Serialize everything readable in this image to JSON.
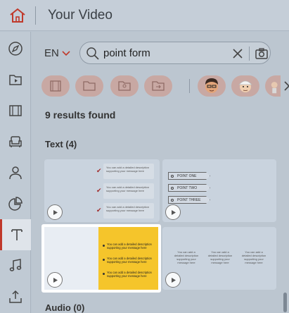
{
  "header": {
    "title": "Your Video",
    "home_icon": "home-icon"
  },
  "sidebar": {
    "items": [
      {
        "icon": "compass-icon",
        "active": false
      },
      {
        "icon": "media-folder-icon",
        "active": false
      },
      {
        "icon": "film-icon",
        "active": false
      },
      {
        "icon": "armchair-icon",
        "active": false
      },
      {
        "icon": "person-icon",
        "active": false
      },
      {
        "icon": "pie-chart-icon",
        "active": false
      },
      {
        "icon": "text-icon",
        "active": true
      },
      {
        "icon": "music-icon",
        "active": false
      },
      {
        "icon": "upload-icon",
        "active": false
      }
    ],
    "active_accent": "#c0392b"
  },
  "search": {
    "language": "EN",
    "query": "point form"
  },
  "categories": [
    {
      "icon": "film-strip-icon"
    },
    {
      "icon": "folder-icon"
    },
    {
      "icon": "image-folder-icon"
    },
    {
      "icon": "export-folder-icon"
    },
    {
      "icon": "character-avatar-icon"
    },
    {
      "icon": "character-avatar-icon"
    },
    {
      "icon": "character-avatar-icon"
    }
  ],
  "results": {
    "count_label": "9 results found"
  },
  "sections": {
    "text_title": "Text (4)",
    "audio_title": "Audio (0)"
  },
  "thumbnails": {
    "check_list": {
      "item_text": "You can add a detailed description supporting your message here"
    },
    "point_list": {
      "items": [
        "POINT ONE",
        "POINT TWO",
        "POINT THREE"
      ]
    },
    "yellow_list": {
      "item_text": "You can add a detailed description supporting your message here",
      "accent": "#f5c52b"
    },
    "three_column": {
      "item_text": "You can add a detailed description supporting your message here"
    }
  }
}
